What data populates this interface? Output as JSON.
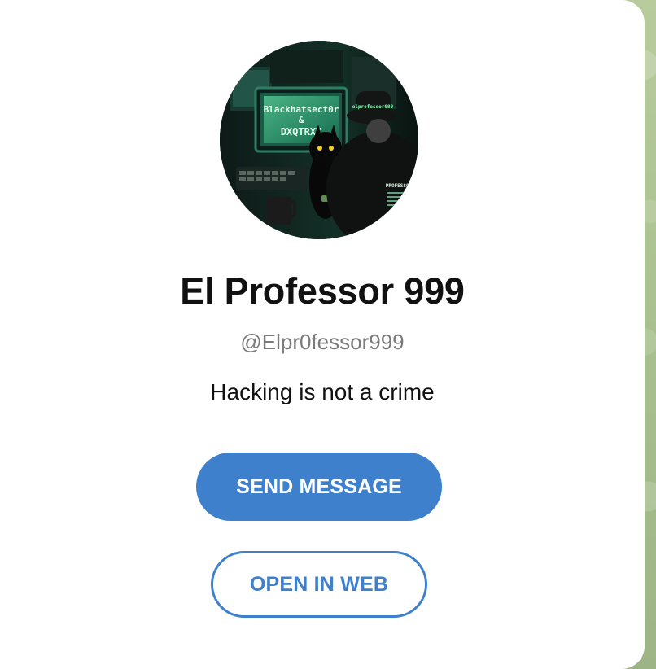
{
  "profile": {
    "name": "El Professor 999",
    "username": "@Elpr0fessor999",
    "bio": "Hacking is not a crime",
    "avatar_text": {
      "monitor_line1": "Blackhatsect0r",
      "monitor_line2": "&",
      "monitor_line3": "DXQTRXX",
      "hat_text": "elprofessor999",
      "jacket_text": "PROFESSOR"
    }
  },
  "actions": {
    "send_message": "SEND MESSAGE",
    "open_in_web": "OPEN IN WEB"
  },
  "colors": {
    "accent": "#3f80cc",
    "background": "#a6bf8e",
    "card": "#ffffff"
  }
}
